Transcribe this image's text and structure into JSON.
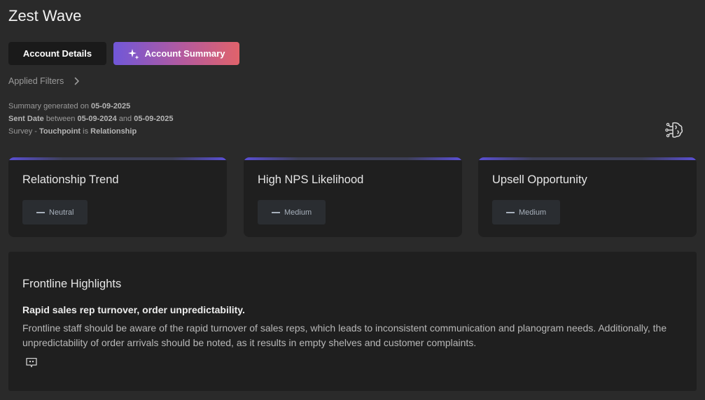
{
  "page": {
    "title": "Zest Wave"
  },
  "tabs": [
    {
      "label": "Account Details",
      "active": false
    },
    {
      "label": "Account Summary",
      "active": true,
      "icon": "sparkle-icon"
    }
  ],
  "filters": {
    "label": "Applied Filters",
    "icon": "chevron-right-icon"
  },
  "meta": {
    "generated_prefix": "Summary generated on",
    "generated_date": "05-09-2025",
    "sent_label": "Sent Date",
    "sent_between": "between",
    "sent_from": "05-09-2024",
    "sent_and": "and",
    "sent_to": "05-09-2025",
    "survey_prefix": "Survey -",
    "touchpoint_label": "Touchpoint",
    "touchpoint_is": "is",
    "touchpoint_value": "Relationship"
  },
  "ai_button": {
    "icon": "brain-circuit-icon"
  },
  "cards": [
    {
      "title": "Relationship Trend",
      "value": "Neutral"
    },
    {
      "title": "High NPS Likelihood",
      "value": "Medium"
    },
    {
      "title": "Upsell Opportunity",
      "value": "Medium"
    }
  ],
  "highlights": {
    "title": "Frontline Highlights",
    "headline": "Rapid sales rep turnover, order unpredictability.",
    "body": "Frontline staff should be aware of the rapid turnover of sales reps, which leads to inconsistent communication and planogram needs. Additionally, the unpredictability of order arrivals should be noted, as it results in empty shelves and customer complaints.",
    "quote_icon": "quote-bubble-icon"
  },
  "colors": {
    "background": "#2a2a2a",
    "card": "#1f1f1f",
    "accent_gradient_start": "#7057d8",
    "accent_gradient_end": "#e0636b"
  }
}
